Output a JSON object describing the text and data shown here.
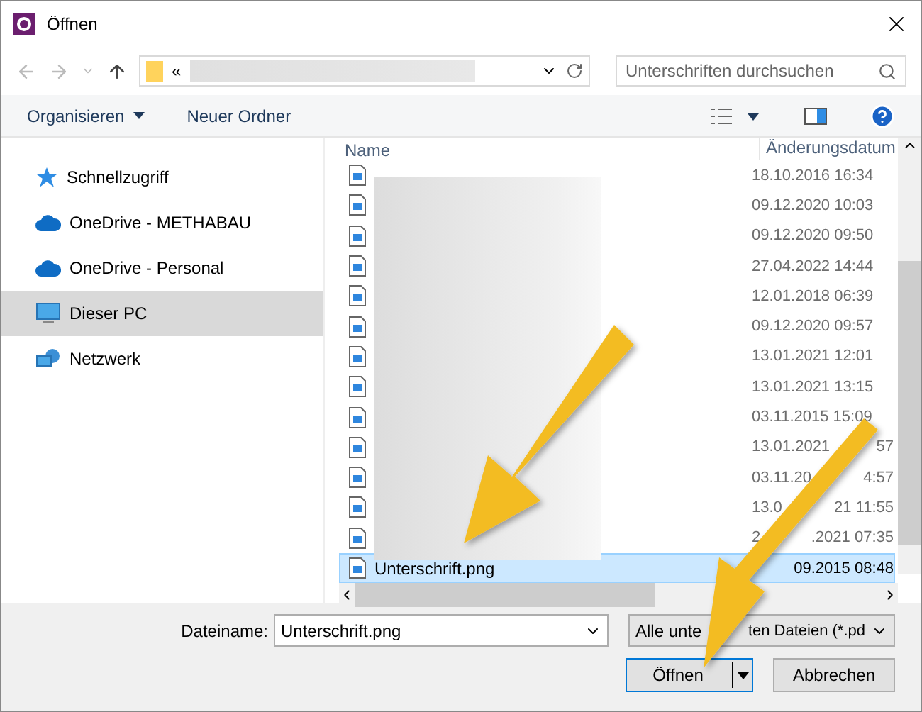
{
  "window": {
    "title": "Öffnen"
  },
  "address": {
    "prefix": "«"
  },
  "search": {
    "placeholder": "Unterschriften durchsuchen"
  },
  "toolbar": {
    "organize": "Organisieren",
    "new_folder": "Neuer Ordner"
  },
  "sidebar": {
    "items": [
      {
        "label": "Schnellzugriff",
        "kind": "star",
        "selected": false
      },
      {
        "label": "OneDrive - METHABAU",
        "kind": "cloud",
        "selected": false
      },
      {
        "label": "OneDrive - Personal",
        "kind": "cloud",
        "selected": false
      },
      {
        "label": "Dieser PC",
        "kind": "pc",
        "selected": true
      },
      {
        "label": "Netzwerk",
        "kind": "network",
        "selected": false
      }
    ]
  },
  "table": {
    "columns": [
      "Name",
      "Änderungsdatum"
    ],
    "rows": [
      {
        "name": "",
        "date": "18.10.2016 16:34",
        "date_tail": "",
        "selected": false
      },
      {
        "name": "",
        "date": "09.12.2020 10:03",
        "date_tail": "",
        "selected": false
      },
      {
        "name": "",
        "date": "09.12.2020 09:50",
        "date_tail": "",
        "selected": false
      },
      {
        "name": "",
        "date": "27.04.2022 14:44",
        "date_tail": "",
        "selected": false
      },
      {
        "name": "",
        "date": "12.01.2018 06:39",
        "date_tail": "",
        "selected": false
      },
      {
        "name": "",
        "date": "09.12.2020 09:57",
        "date_tail": "",
        "selected": false
      },
      {
        "name": "",
        "date": "13.01.2021 12:01",
        "date_tail": "",
        "selected": false
      },
      {
        "name": "",
        "date": "13.01.2021 13:15",
        "date_tail": "",
        "selected": false
      },
      {
        "name": "",
        "date": "03.11.2015 15:09",
        "date_tail": "",
        "selected": false
      },
      {
        "name": "",
        "date": "13.01.2021",
        "date_tail": "57",
        "selected": false
      },
      {
        "name": "",
        "date": "03.11.20",
        "date_tail": "4:57",
        "selected": false
      },
      {
        "name": "",
        "date": "13.0",
        "date_tail": "21 11:55",
        "selected": false
      },
      {
        "name": "",
        "date": "2",
        "date_tail": ".2021 07:35",
        "selected": false
      },
      {
        "name": "Unterschrift.png",
        "date": "",
        "date_tail": "09.2015 08:48",
        "selected": true
      }
    ]
  },
  "footer": {
    "filename_label": "Dateiname:",
    "filename": "Unterschrift.png",
    "filetype": "Alle unte",
    "filetype_tail": "ten Dateien (*.pd",
    "open": "Öffnen",
    "cancel": "Abbrechen"
  }
}
